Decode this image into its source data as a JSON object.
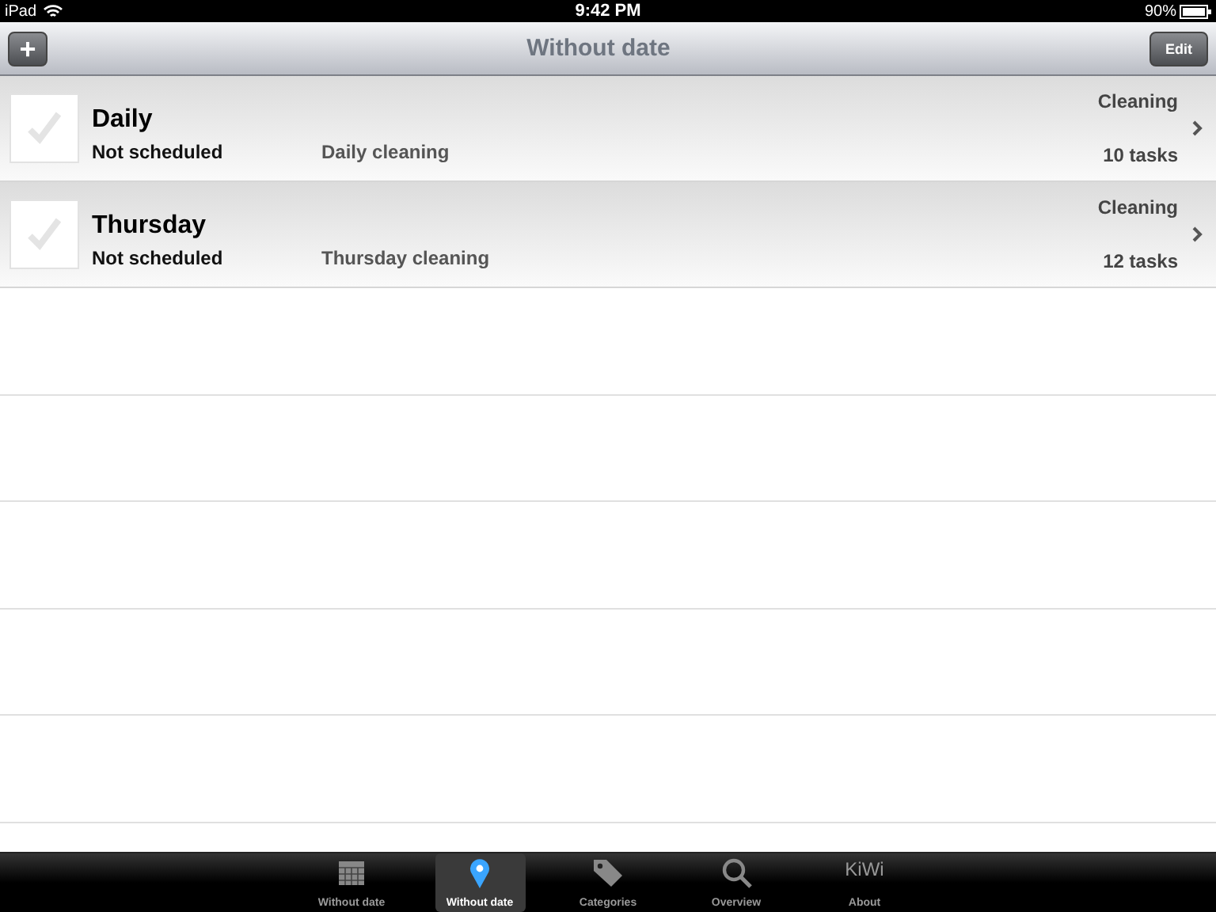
{
  "status_bar": {
    "device": "iPad",
    "time": "9:42 PM",
    "battery": "90%"
  },
  "nav_bar": {
    "add_button": "+",
    "title": "Without date",
    "edit_button": "Edit"
  },
  "rows": [
    {
      "checked": false,
      "title": "Daily",
      "schedule": "Not scheduled",
      "description": "Daily cleaning",
      "category": "Cleaning",
      "count": "10 tasks"
    },
    {
      "checked": false,
      "title": "Thursday",
      "schedule": "Not scheduled",
      "description": "Thursday cleaning",
      "category": "Cleaning",
      "count": "12 tasks"
    }
  ],
  "tab_bar": [
    {
      "kind": "calendar",
      "label": "Without date",
      "selected": false
    },
    {
      "kind": "pin",
      "label": "Without date",
      "selected": true
    },
    {
      "kind": "tag",
      "label": "Categories",
      "selected": false
    },
    {
      "kind": "search",
      "label": "Overview",
      "selected": false
    },
    {
      "kind": "text",
      "icon_text": "KiWi",
      "label": "About",
      "selected": false
    }
  ]
}
